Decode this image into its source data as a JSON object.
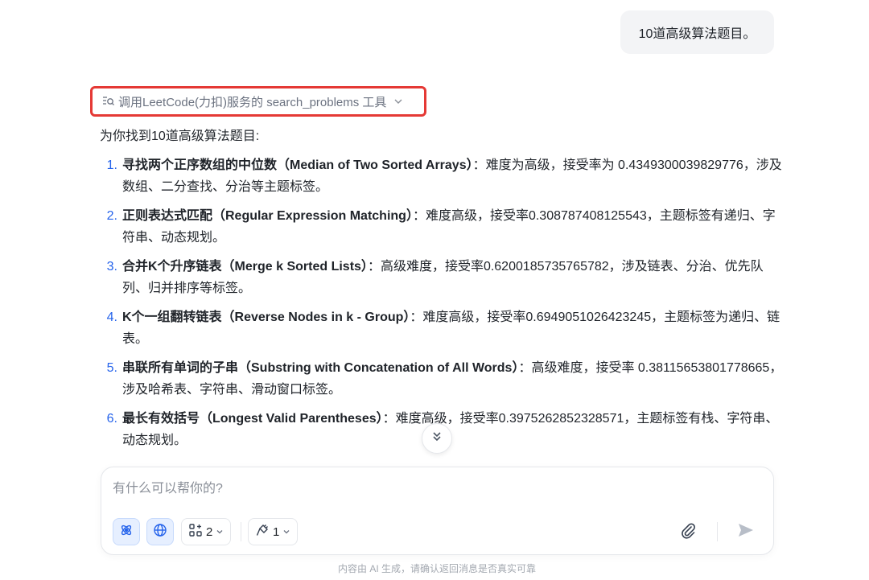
{
  "user_message": "10道高级算法题目。",
  "tool_call": {
    "label": "调用LeetCode(力扣)服务的 search_problems 工具"
  },
  "assistant": {
    "intro": "为你找到10道高级算法题目:",
    "items": [
      {
        "num": "1.",
        "title": "寻找两个正序数组的中位数（Median of Two Sorted Arrays）",
        "desc": "：难度为高级，接受率为 0.4349300039829776，涉及数组、二分查找、分治等主题标签。"
      },
      {
        "num": "2.",
        "title": "正则表达式匹配（Regular Expression Matching）",
        "desc": "：难度高级，接受率0.308787408125543，主题标签有递归、字符串、动态规划。"
      },
      {
        "num": "3.",
        "title": "合并K个升序链表（Merge k Sorted Lists）",
        "desc": "：高级难度，接受率0.6200185735765782，涉及链表、分治、优先队列、归并排序等标签。"
      },
      {
        "num": "4.",
        "title": "K个一组翻转链表（Reverse Nodes in k - Group）",
        "desc": "：难度高级，接受率0.6949051026423245，主题标签为递归、链表。"
      },
      {
        "num": "5.",
        "title": "串联所有单词的子串（Substring with Concatenation of All Words）",
        "desc": "：高级难度，接受率 0.38115653801778665，涉及哈希表、字符串、滑动窗口标签。"
      },
      {
        "num": "6.",
        "title": "最长有效括号（Longest Valid Parentheses）",
        "desc": "：难度高级，接受率0.3975262852328571，主题标签有栈、字符串、动态规划。"
      }
    ]
  },
  "composer": {
    "placeholder": "有什么可以帮你的?",
    "dropdown_1_value": "2",
    "dropdown_2_value": "1"
  },
  "icons": {
    "tool": "search-list-icon",
    "expand": "chevron-down-icon",
    "scroll": "double-chevron-down-icon",
    "agent": "atom-icon",
    "web": "globe-icon",
    "plugins": "grid-plus-icon",
    "tools": "plug-icon",
    "attach": "paperclip-icon",
    "send": "send-icon"
  },
  "colors": {
    "accent": "#2563eb",
    "highlight_border": "#e53935",
    "active_bg": "#e6efff"
  },
  "disclaimer": "内容由 AI 生成，请确认返回消息是否真实可靠"
}
